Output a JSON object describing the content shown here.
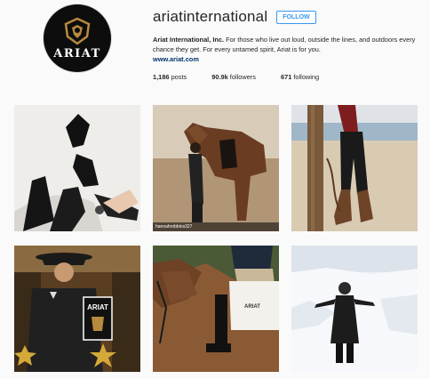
{
  "profile": {
    "username": "ariatinternational",
    "follow_label": "FOLLOW",
    "bio_name": "Ariat International, Inc.",
    "bio_text": "For those who live out loud, outside the lines, and outdoors every chance they get. For every untamed spirit, Ariat is for you.",
    "website": "www.ariat.com",
    "avatar_brand": "ARIAT",
    "stats": {
      "posts_value": "1,186",
      "posts_label": "posts",
      "followers_value": "90.9k",
      "followers_label": "followers",
      "following_value": "671",
      "following_label": "following"
    }
  },
  "posts": {
    "p2_credit": "hannahrobbins327",
    "p4_sign": "ARIAT",
    "p5_pad": "ARIAT"
  },
  "colors": {
    "accent_blue": "#3897f0",
    "link_navy": "#003569",
    "avatar_gold": "#b88a3e"
  },
  "icons": [
    "ariat-logo-icon"
  ]
}
